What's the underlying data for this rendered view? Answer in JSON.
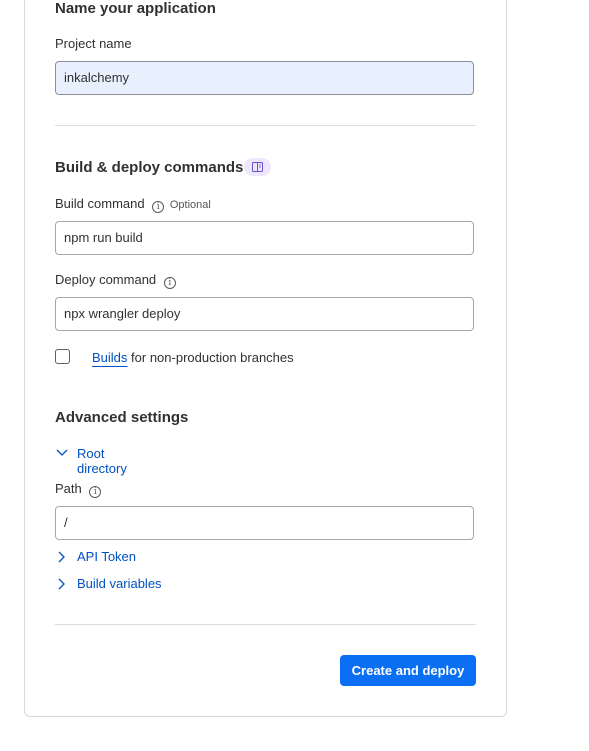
{
  "name_section": {
    "title": "Name your application",
    "project_label": "Project name",
    "project_value": "inkalchemy"
  },
  "build_section": {
    "title": "Build & deploy commands",
    "build_label": "Build command",
    "build_optional": "Optional",
    "build_value": "npm run build",
    "deploy_label": "Deploy command",
    "deploy_value": "npx wrangler deploy",
    "branches_link": "Builds",
    "branches_text": " for non-production branches",
    "branches_checked": false
  },
  "advanced": {
    "title": "Advanced settings",
    "root_directory": "Root directory",
    "path_label": "Path",
    "path_value": "/",
    "api_token": "API Token",
    "build_variables": "Build variables"
  },
  "footer": {
    "submit_label": "Create and deploy"
  },
  "icons": {
    "info": "info-icon",
    "docs": "book-icon",
    "expanded": "chevron-down-icon",
    "collapsed": "chevron-right-icon"
  },
  "colors": {
    "accent": "#0b6ff4",
    "link": "#0051c3",
    "autofill": "#e8f0fe",
    "badge": "#ede8fb"
  }
}
